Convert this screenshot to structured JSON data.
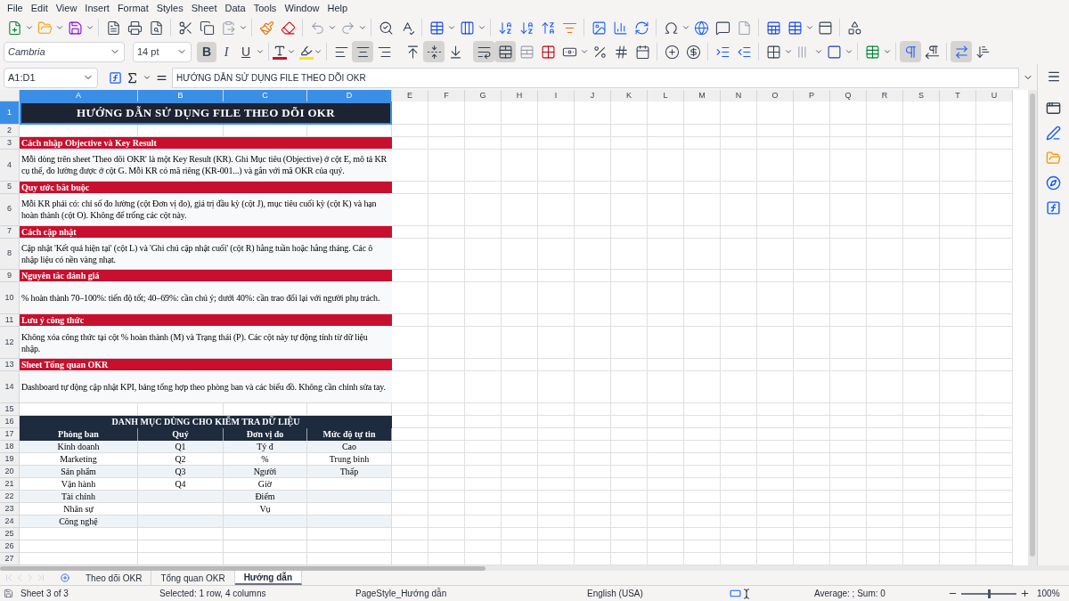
{
  "menu": [
    "File",
    "Edit",
    "View",
    "Insert",
    "Format",
    "Styles",
    "Sheet",
    "Data",
    "Tools",
    "Window",
    "Help"
  ],
  "font_box": {
    "font_name": "Cambria",
    "font_size": "14 pt"
  },
  "format_buttons": [
    {
      "kind": "bold",
      "label": "B",
      "on": true
    },
    {
      "kind": "italic",
      "label": "I",
      "on": false
    },
    {
      "kind": "underline",
      "label": "U",
      "on": false
    }
  ],
  "alignment_buttons": [
    {
      "kind": "left",
      "on": false
    },
    {
      "kind": "center",
      "on": true
    },
    {
      "kind": "right",
      "on": false
    },
    {
      "kind": "top",
      "on": false
    },
    {
      "kind": "middle",
      "on": true
    },
    {
      "kind": "bottom",
      "on": false
    },
    {
      "kind": "wrap",
      "on": true
    },
    {
      "kind": "merge",
      "on": true
    }
  ],
  "formula_bar": {
    "name_box": "A1:D1",
    "formula": "HƯỚNG DẪN SỬ DỤNG FILE THEO DÕI OKR"
  },
  "columns": [
    {
      "label": "A",
      "selected": true
    },
    {
      "label": "B",
      "selected": true
    },
    {
      "label": "C",
      "selected": true
    },
    {
      "label": "D",
      "selected": true
    },
    {
      "label": "E",
      "selected": false
    },
    {
      "label": "F",
      "selected": false
    },
    {
      "label": "G",
      "selected": false
    },
    {
      "label": "H",
      "selected": false
    },
    {
      "label": "I",
      "selected": false
    },
    {
      "label": "J",
      "selected": false
    },
    {
      "label": "K",
      "selected": false
    },
    {
      "label": "L",
      "selected": false
    },
    {
      "label": "M",
      "selected": false
    },
    {
      "label": "N",
      "selected": false
    },
    {
      "label": "O",
      "selected": false
    },
    {
      "label": "P",
      "selected": false
    },
    {
      "label": "Q",
      "selected": false
    },
    {
      "label": "R",
      "selected": false
    },
    {
      "label": "S",
      "selected": false
    },
    {
      "label": "T",
      "selected": false
    },
    {
      "label": "U",
      "selected": false
    }
  ],
  "row_numbers": [
    {
      "label": "1",
      "selected": true
    },
    {
      "label": "2",
      "selected": false
    },
    {
      "label": "3",
      "selected": false
    },
    {
      "label": "4",
      "selected": false
    },
    {
      "label": "5",
      "selected": false
    },
    {
      "label": "6",
      "selected": false
    },
    {
      "label": "7",
      "selected": false
    },
    {
      "label": "8",
      "selected": false
    },
    {
      "label": "9",
      "selected": false
    },
    {
      "label": "10",
      "selected": false
    },
    {
      "label": "11",
      "selected": false
    },
    {
      "label": "12",
      "selected": false
    },
    {
      "label": "13",
      "selected": false
    },
    {
      "label": "14",
      "selected": false
    },
    {
      "label": "15",
      "selected": false
    },
    {
      "label": "16",
      "selected": false
    },
    {
      "label": "17",
      "selected": false
    },
    {
      "label": "18",
      "selected": false
    },
    {
      "label": "19",
      "selected": false
    },
    {
      "label": "20",
      "selected": false
    },
    {
      "label": "21",
      "selected": false
    },
    {
      "label": "22",
      "selected": false
    },
    {
      "label": "23",
      "selected": false
    },
    {
      "label": "24",
      "selected": false
    },
    {
      "label": "25",
      "selected": false
    },
    {
      "label": "26",
      "selected": false
    },
    {
      "label": "27",
      "selected": false
    }
  ],
  "title": "HƯỚNG DẪN SỬ DỤNG FILE THEO DÕI OKR",
  "sections": [
    {
      "heading": "Cách nhập Objective và Key Result",
      "body": "Mỗi dòng trên sheet 'Theo dõi OKR' là một Key Result (KR). Ghi Mục tiêu (Objective) ở cột E, mô tả KR cụ thể, đo lường được ở cột G. Mỗi KR có mã riêng (KR-001...) và gắn với mã OKR của quý."
    },
    {
      "heading": "Quy ước bắt buộc",
      "body": "Mỗi KR phải có: chỉ số đo lường (cột Đơn vị đo), giá trị đầu kỳ (cột J), mục tiêu cuối kỳ (cột K) và hạn hoàn thành (cột O). Không để trống các cột này."
    },
    {
      "heading": "Cách cập nhật",
      "body": "Cập nhật 'Kết quả hiện tại' (cột L) và 'Ghi chú cập nhật cuối' (cột R) hằng tuần hoặc hằng tháng. Các ô nhập liệu có nền vàng nhạt."
    },
    {
      "heading": "Nguyên tắc đánh giá",
      "body": "% hoàn thành 70–100%: tiến độ tốt; 40–69%: cần chú ý; dưới 40%: cần trao đổi lại với người phụ trách."
    },
    {
      "heading": "Lưu ý công thức",
      "body": "Không xóa công thức tại cột % hoàn thành (M) và Trạng thái (P). Các cột này tự động tính từ dữ liệu nhập."
    },
    {
      "heading": "Sheet Tổng quan OKR",
      "body": "Dashboard tự động cập nhật KPI, bảng tổng hợp theo phòng ban và các biểu đồ. Không cần chỉnh sửa tay."
    }
  ],
  "catalog": {
    "title": "DANH MỤC DÙNG CHO KIỂM TRA DỮ LIỆU",
    "columns": [
      {
        "header": "Phòng ban",
        "items": [
          "Kinh doanh",
          "Marketing",
          "Sản phẩm",
          "Vận hành",
          "Tài chính",
          "Nhân sự",
          "Công nghệ"
        ]
      },
      {
        "header": "Quý",
        "items": [
          "Q1",
          "Q2",
          "Q3",
          "Q4"
        ]
      },
      {
        "header": "Đơn vị đo",
        "items": [
          "Tỷ đ",
          "%",
          "Người",
          "Giờ",
          "Điểm",
          "Vụ"
        ]
      },
      {
        "header": "Mức độ tự tin",
        "items": [
          "Cao",
          "Trung bình",
          "Thấp"
        ]
      }
    ]
  },
  "sheet_tabs": [
    {
      "label": "Theo dõi OKR",
      "selected": false
    },
    {
      "label": "Tổng quan OKR",
      "selected": false
    },
    {
      "label": "Hướng dẫn",
      "selected": true
    }
  ],
  "status_bar": {
    "sheet": "Sheet 3 of 3",
    "selection": "Selected: 1 row, 4 columns",
    "page_style": "PageStyle_Hướng dẫn",
    "language": "English (USA)",
    "summary": "Average: ; Sum: 0",
    "zoom": "100%",
    "zoom_slider": {
      "level": 0.5
    }
  }
}
